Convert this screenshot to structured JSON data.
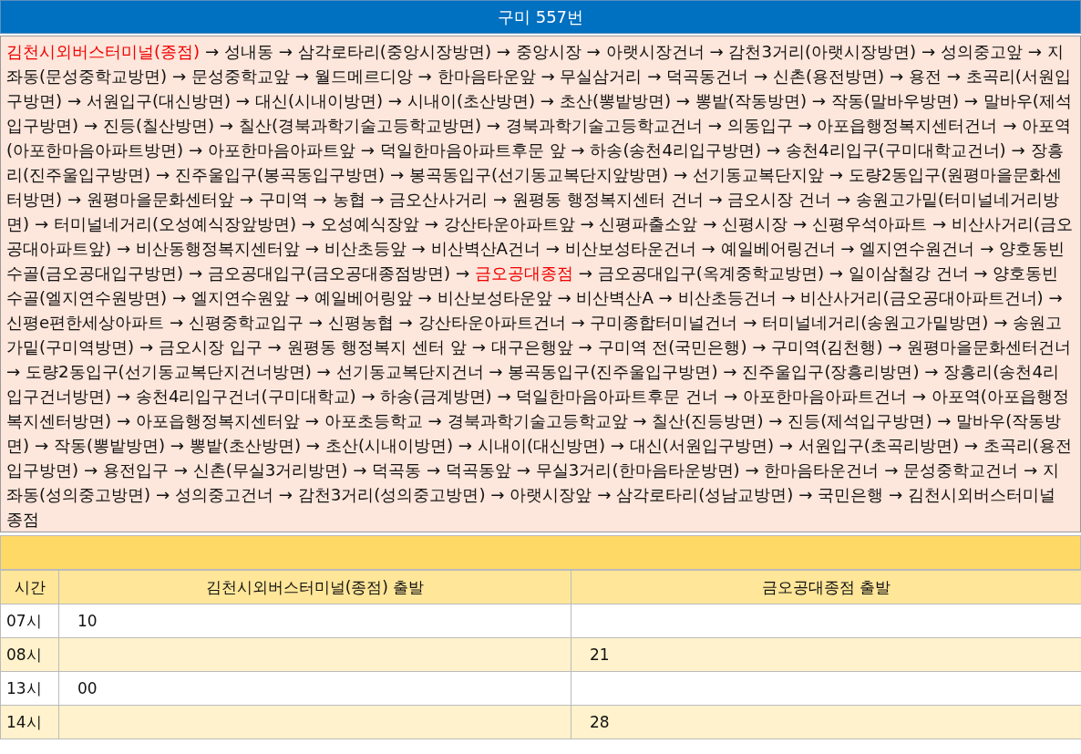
{
  "title": "구미 557번",
  "route": [
    {
      "text": "김천시외버스터미널(종점)",
      "highlighted": true
    },
    {
      "text": " → 성내동 → 삼각로타리(중앙시장방면) → 중앙시장 → 아랫시장건너 → 감천3거리(아랫시장방면) → 성의중고앞 → 지좌동(문성중학교방면) → 문성중학교앞 → 월드메르디앙 → 한마음타운앞 → 무실삼거리 → 덕곡동건너 → 신촌(용전방면) → 용전 → 초곡리(서원입구방면) → 서원입구(대신방면) → 대신(시내이방면) → 시내이(초산방면) → 초산(뽕밭방면) → 뽕밭(작동방면) → 작동(말바우방면) → 말바우(제석입구방면) → 진등(칠산방면) → 칠산(경북과학기술고등학교방면) → 경북과학기술고등학교건너 → 의동입구 → 아포읍행정복지센터건너 → 아포역(아포한마음아파트방면) → 아포한마음아파트앞 → 덕일한마음아파트후문 앞 → 하송(송천4리입구방면) → 송천4리입구(구미대학교건너) → 장흥리(진주울입구방면) → 진주울입구(봉곡동입구방면) → 봉곡동입구(선기동교복단지앞방면) → 선기동교복단지앞 → 도량2동입구(원평마을문화센터방면) → 원평마을문화센터앞 → 구미역 → 농협 → 금오산사거리 → 원평동 행정복지센터 건너 → 금오시장 건너 → 송원고가밑(터미널네거리방면) → 터미널네거리(오성예식장앞방면) → 오성예식장앞 → 강산타운아파트앞 → 신평파출소앞 → 신평시장 → 신평우석아파트 → 비산사거리(금오공대아파트앞) → 비산동행정복지센터앞 → 비산초등앞 → 비산벽산A건너 → 비산보성타운건너 → 예일베어링건너 → 엘지연수원건너 → 양호동빈수골(금오공대입구방면) → 금오공대입구(금오공대종점방면) → ",
      "highlighted": false
    },
    {
      "text": "금오공대종점",
      "highlighted": true
    },
    {
      "text": " → 금오공대입구(옥계중학교방면) → 일이삼철강 건너 → 양호동빈수골(엘지연수원방면) → 엘지연수원앞 → 예일베어링앞 → 비산보성타운앞 → 비산벽산A → 비산초등건너 → 비산사거리(금오공대아파트건너) → 신평e편한세상아파트 → 신평중학교입구 → 신평농협 → 강산타운아파트건너 → 구미종합터미널건너 → 터미널네거리(송원고가밑방면) → 송원고가밑(구미역방면) → 금오시장 입구 → 원평동 행정복지 센터 앞 → 대구은행앞 → 구미역 전(국민은행) → 구미역(김천행) → 원평마을문화센터건너 → 도량2동입구(선기동교복단지건너방면) → 선기동교복단지건너 → 봉곡동입구(진주울입구방면) → 진주울입구(장흥리방면) → 장흥리(송천4리입구건너방면) → 송천4리입구건너(구미대학교) → 하송(금계방면) → 덕일한마음아파트후문 건너 → 아포한마음아파트건너 → 아포역(아포읍행정복지센터방면) → 아포읍행정복지센터앞 → 아포초등학교 → 경북과학기술고등학교앞 → 칠산(진등방면) → 진등(제석입구방면) → 말바우(작동방면) → 작동(뽕밭방면) → 뽕밭(초산방면) → 초산(시내이방면) → 시내이(대신방면) → 대신(서원입구방면) → 서원입구(초곡리방면) → 초곡리(용전입구방면) → 용전입구 → 신촌(무실3거리방면) → 덕곡동 → 덕곡동앞 → 무실3거리(한마음타운방면) → 한마음타운건너 → 문성중학교건너 → 지좌동(성의중고방면) → 성의중고건너 → 감천3거리(성의중고방면) → 아랫시장앞 → 삼각로타리(성남교방면) → 국민은행 → 김천시외버스터미널 종점",
      "highlighted": false
    }
  ],
  "table": {
    "columns": [
      "시간",
      "김천시외버스터미널(종점) 출발",
      "금오공대종점 출발"
    ],
    "rows": [
      [
        "07시",
        "10",
        ""
      ],
      [
        "08시",
        "",
        "21"
      ],
      [
        "13시",
        "00",
        ""
      ],
      [
        "14시",
        "",
        "28"
      ]
    ]
  }
}
